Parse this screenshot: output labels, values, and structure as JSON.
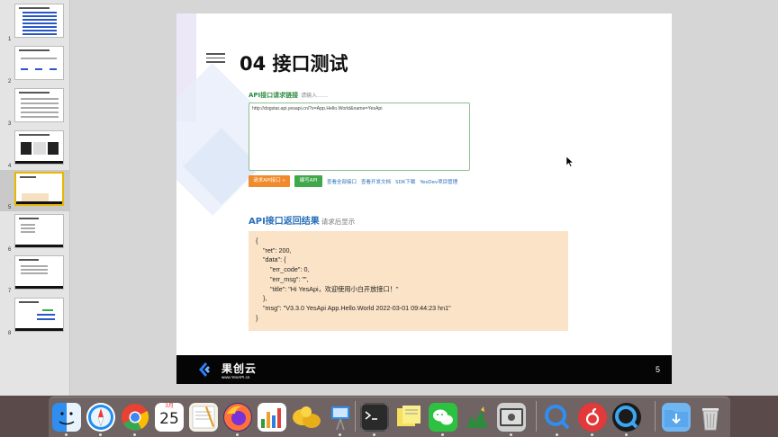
{
  "slide_panel": {
    "thumbnails": [
      {
        "number": "1"
      },
      {
        "number": "2"
      },
      {
        "number": "3"
      },
      {
        "number": "4"
      },
      {
        "number": "5",
        "selected": true
      },
      {
        "number": "6"
      },
      {
        "number": "7"
      },
      {
        "number": "8"
      }
    ]
  },
  "slide": {
    "title": "04 接口测试",
    "request_label": "API接口请求链接",
    "request_hint": "请输入……",
    "request_url": "http://dogstar.api.yesapi.cn/?s=App.Hello.World&name=YesApi",
    "request_button": "请求API接口 »",
    "write_button": "编写API",
    "links": [
      "查看全部接口",
      "查看开发文档",
      "SDK下载",
      "YesDev项目管理"
    ],
    "response_label": "API接口返回结果",
    "response_hint": "请求后显示",
    "response_lines": [
      "{",
      "    \"ret\": 200,",
      "    \"data\": {",
      "        \"err_code\": 0,",
      "        \"err_msg\": \"\",",
      "        \"title\": \"Hi YesApi，欢迎使用小白开放接口！\"",
      "    },",
      "    \"msg\": \"V3.3.0 YesApi App.Hello.World 2022-03-01 09:44:23 hn1\"",
      "}"
    ],
    "footer_brand": "果创云",
    "footer_url": "www.YesAPI.cn",
    "page_number": "5"
  },
  "dock": {
    "calendar_day": "25",
    "calendar_month": "3月",
    "apps": [
      "finder-icon",
      "safari-icon",
      "chrome-icon",
      "calendar-icon",
      "textedit-icon",
      "firefox-icon",
      "numbers-icon",
      "keynote-icon",
      "terminal-icon",
      "stickies-icon",
      "wechat-icon",
      "robinhood-icon",
      "screenshot-icon",
      "qq-icon",
      "netease-music-icon",
      "quicktime-icon",
      "downloads-icon",
      "trash-icon"
    ]
  },
  "colors": {
    "request_green": "#2e8b3e",
    "response_blue": "#2a6fb8",
    "response_bg": "#fbe3c7",
    "button_orange": "#f08a2c",
    "button_green": "#3fa84a"
  }
}
